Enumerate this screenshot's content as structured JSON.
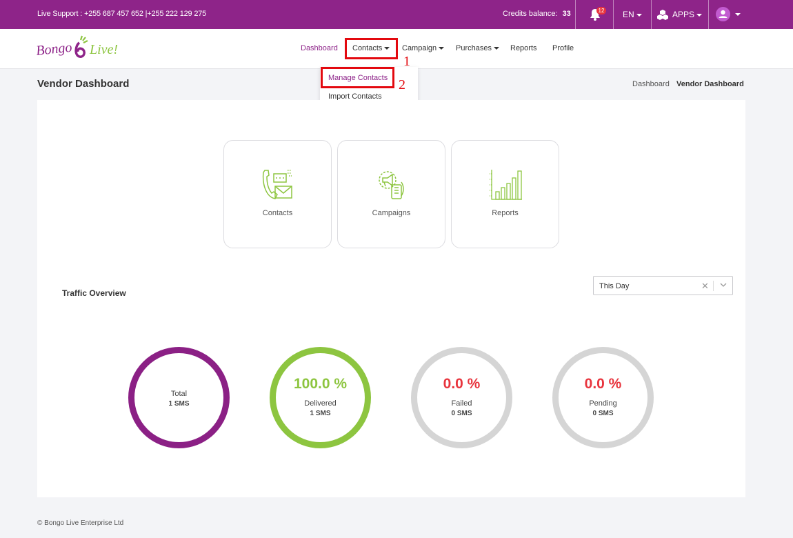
{
  "topbar": {
    "support_label": "Live Support",
    "support_numbers": ": +255 687 457 652 |+255 222 129 275",
    "credits_label": "Credits balance:",
    "credits_value": "33",
    "notification_count": "12",
    "language": "EN",
    "apps_label": "APPS",
    "bg_color": "#8e2489"
  },
  "nav": {
    "items": [
      {
        "label": "Dashboard"
      },
      {
        "label": "Contacts"
      },
      {
        "label": "Campaign"
      },
      {
        "label": "Purchases"
      },
      {
        "label": "Reports"
      },
      {
        "label": "Profile"
      }
    ],
    "active_color": "#8e2489"
  },
  "annotations": {
    "step1": "1",
    "step2": "2",
    "color": "#e3090f"
  },
  "contacts_menu": {
    "items": [
      "Manage Contacts",
      "Import Contacts"
    ]
  },
  "page": {
    "title": "Vendor Dashboard",
    "breadcrumb": [
      "Dashboard",
      "Vendor Dashboard"
    ]
  },
  "tiles": [
    {
      "label": "Contacts",
      "icon": "contacts-icon"
    },
    {
      "label": "Campaigns",
      "icon": "campaigns-icon"
    },
    {
      "label": "Reports",
      "icon": "reports-icon"
    }
  ],
  "traffic": {
    "title": "Traffic Overview",
    "period_value": "This Day",
    "stats": [
      {
        "pct": "",
        "label": "Total",
        "sms": "1 SMS",
        "ring_color": "#8b2085"
      },
      {
        "pct": "100.0 %",
        "label": "Delivered",
        "sms": "1 SMS",
        "ring_color": "#8dc540",
        "pct_color": "#8dc540"
      },
      {
        "pct": "0.0 %",
        "label": "Failed",
        "sms": "0 SMS",
        "ring_color": "#d5d5d5",
        "pct_color": "#e8343d"
      },
      {
        "pct": "0.0 %",
        "label": "Pending",
        "sms": "0 SMS",
        "ring_color": "#d5d5d5",
        "pct_color": "#e8343d"
      }
    ]
  },
  "footer": {
    "text": "© Bongo Live Enterprise Ltd"
  },
  "brand": {
    "logo_text_1": "Bongo",
    "logo_text_2": "Live!"
  }
}
